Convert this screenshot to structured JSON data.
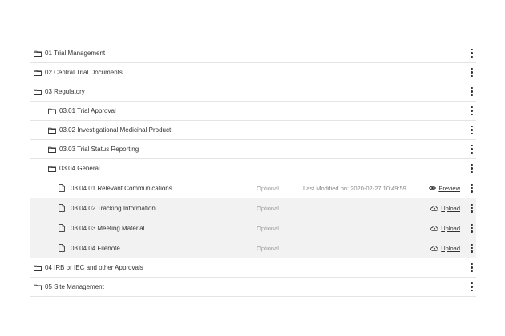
{
  "rows": [
    {
      "type": "folder",
      "level": 0,
      "label": "01 Trial Management"
    },
    {
      "type": "folder",
      "level": 0,
      "label": "02 Central Trial Documents"
    },
    {
      "type": "folder",
      "level": 0,
      "label": "03 Regulatory"
    },
    {
      "type": "folder",
      "level": 1,
      "label": "03.01 Trial Approval"
    },
    {
      "type": "folder",
      "level": 1,
      "label": "03.02 Investigational Medicinal Product"
    },
    {
      "type": "folder",
      "level": 1,
      "label": "03.03 Trial Status Reporting"
    },
    {
      "type": "folder",
      "level": 1,
      "label": "03.04 General"
    },
    {
      "type": "file",
      "level": 2,
      "label": "03.04.01 Relevant Communications",
      "status": "Optional",
      "modified": "Last Modified on: 2020-02-27 10:49:59",
      "action": "Preview",
      "action_icon": "eye-icon"
    },
    {
      "type": "file",
      "level": 2,
      "label": "03.04.02 Tracking Information",
      "status": "Optional",
      "modified": "",
      "action": "Upload",
      "action_icon": "cloud-upload-icon"
    },
    {
      "type": "file",
      "level": 2,
      "label": "03.04.03 Meeting Material",
      "status": "Optional",
      "modified": "",
      "action": "Upload",
      "action_icon": "cloud-upload-icon"
    },
    {
      "type": "file",
      "level": 2,
      "label": "03.04.04 Filenote",
      "status": "Optional",
      "modified": "",
      "action": "Upload",
      "action_icon": "cloud-upload-icon"
    },
    {
      "type": "folder",
      "level": 0,
      "label": "04 IRB or IEC and other Approvals"
    },
    {
      "type": "folder",
      "level": 0,
      "label": "05 Site Management"
    }
  ],
  "colors": {
    "text": "#333333",
    "muted": "#9a9a9a",
    "row_alt": "#f2f2f2",
    "divider": "#e4e4e4"
  }
}
